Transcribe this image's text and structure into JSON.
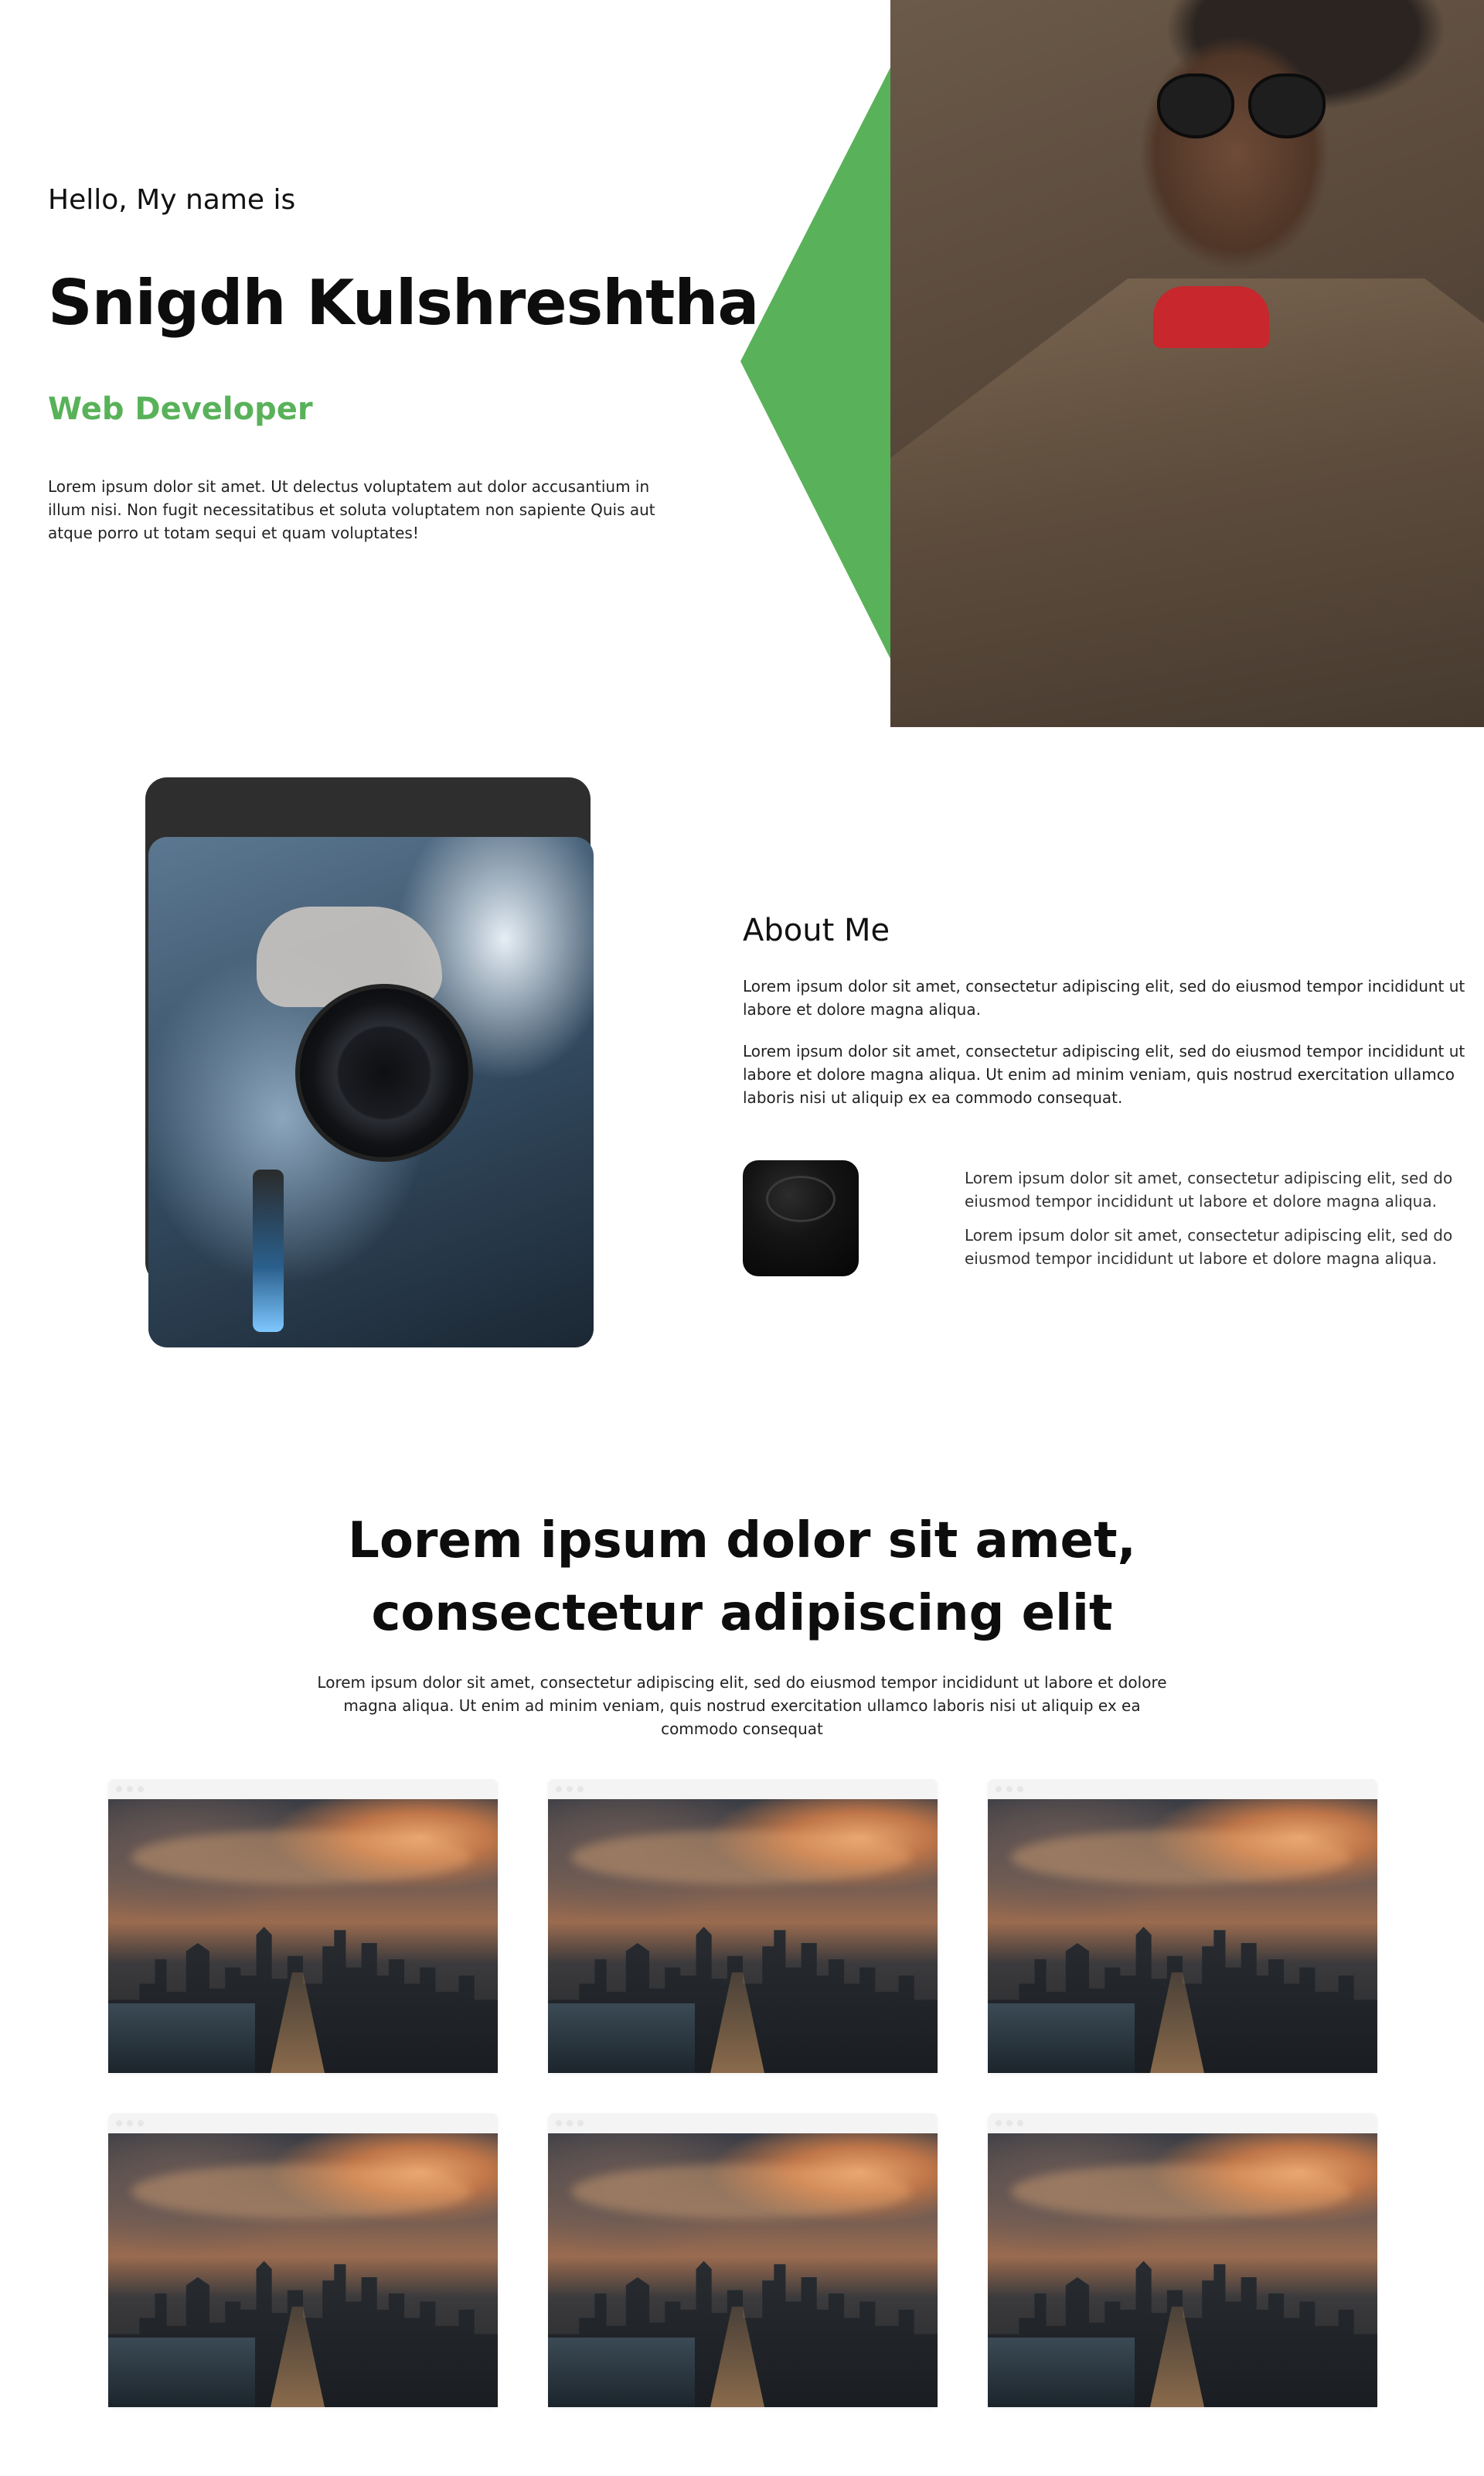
{
  "colors": {
    "accent": "#59b259",
    "text": "#111111",
    "background": "#ffffff",
    "card_bg": "#f4f4f4"
  },
  "hero": {
    "greeting": "Hello, My name is",
    "name": "Snigdh Kulshreshtha",
    "role": "Web Developer",
    "intro": "Lorem ipsum dolor sit amet. Ut delectus voluptatem aut dolor accusantium in illum nisi. Non fugit necessitatibus et soluta voluptatem non sapiente Quis aut atque porro ut totam sequi et quam voluptates!"
  },
  "about": {
    "title": "About Me",
    "paragraph_1": "Lorem ipsum dolor sit amet, consectetur adipiscing elit, sed do eiusmod tempor incididunt ut labore et dolore magna aliqua.",
    "paragraph_2": "Lorem ipsum dolor sit amet, consectetur adipiscing elit, sed do eiusmod tempor incididunt ut labore et dolore magna aliqua. Ut enim ad minim veniam, quis nostrud exercitation ullamco laboris nisi ut aliquip ex ea commodo consequat.",
    "paragraph_3": "Lorem ipsum dolor sit amet, consectetur adipiscing elit, sed do eiusmod tempor incididunt ut labore et dolore magna aliqua.",
    "paragraph_4": "Lorem ipsum dolor sit amet, consectetur adipiscing elit, sed do eiusmod tempor incididunt ut labore et dolore magna aliqua."
  },
  "gallery": {
    "heading_line_1": "Lorem ipsum dolor sit amet,",
    "heading_line_2": "consectetur adipiscing elit",
    "subtitle": "Lorem ipsum dolor sit amet, consectetur adipiscing elit, sed do eiusmod tempor incididunt ut labore et dolore magna aliqua. Ut enim ad minim veniam, quis nostrud exercitation ullamco laboris nisi ut aliquip ex ea commodo consequat",
    "cards": [
      {
        "image": "city-skyline-photo"
      },
      {
        "image": "city-skyline-photo"
      },
      {
        "image": "city-skyline-photo"
      },
      {
        "image": "city-skyline-photo"
      },
      {
        "image": "city-skyline-photo"
      },
      {
        "image": "city-skyline-photo"
      }
    ]
  }
}
